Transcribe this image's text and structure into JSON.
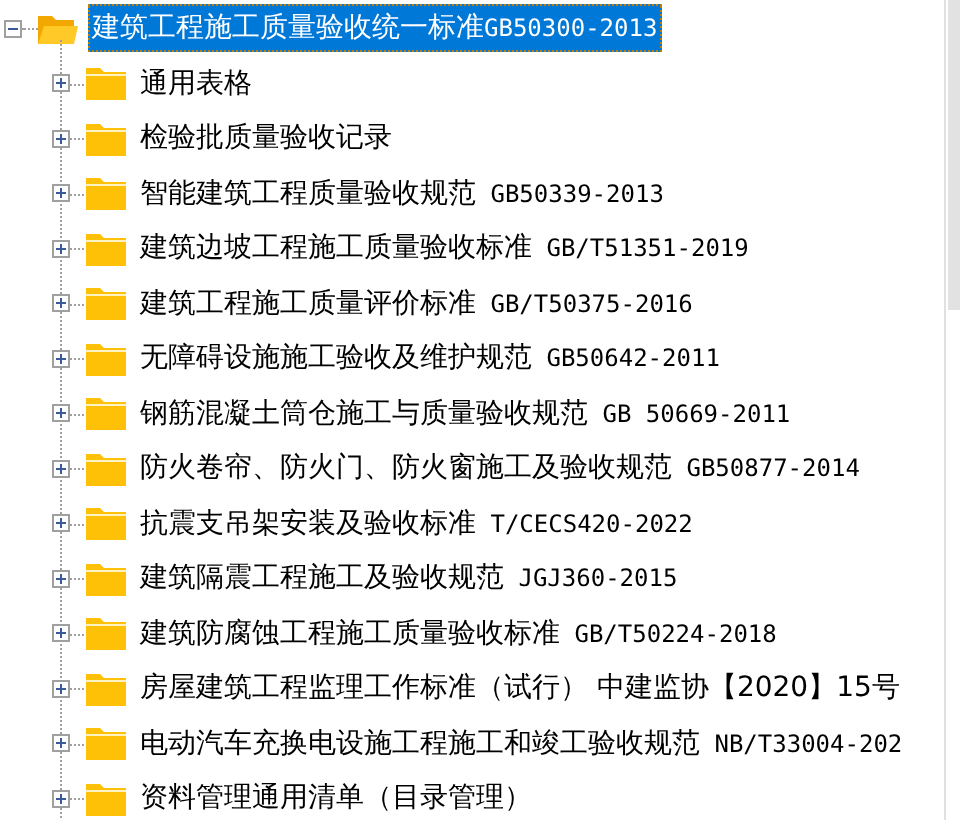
{
  "tree": {
    "root": {
      "name": "建筑工程施工质量验收统一标准",
      "code": "GB50300-2013",
      "expanded": true,
      "selected": true,
      "children": [
        {
          "name": "通用表格",
          "expanded": false,
          "selected": false
        },
        {
          "name": "检验批质量验收记录",
          "expanded": false,
          "selected": false
        },
        {
          "name": "智能建筑工程质量验收规范",
          "code": " GB50339-2013",
          "expanded": false,
          "selected": false
        },
        {
          "name": "建筑边坡工程施工质量验收标准",
          "code": " GB/T51351-2019",
          "expanded": false,
          "selected": false
        },
        {
          "name": "建筑工程施工质量评价标准",
          "code": " GB/T50375-2016",
          "expanded": false,
          "selected": false
        },
        {
          "name": "无障碍设施施工验收及维护规范",
          "code": " GB50642-2011",
          "expanded": false,
          "selected": false
        },
        {
          "name": "钢筋混凝土筒仓施工与质量验收规范",
          "code": " GB 50669-2011",
          "expanded": false,
          "selected": false
        },
        {
          "name": "防火卷帘、防火门、防火窗施工及验收规范",
          "code": " GB50877-2014",
          "expanded": false,
          "selected": false
        },
        {
          "name": "抗震支吊架安装及验收标准",
          "code": " T/CECS420-2022",
          "expanded": false,
          "selected": false
        },
        {
          "name": "建筑隔震工程施工及验收规范",
          "code": " JGJ360-2015",
          "expanded": false,
          "selected": false
        },
        {
          "name": "建筑防腐蚀工程施工质量验收标准",
          "code": " GB/T50224-2018",
          "expanded": false,
          "selected": false
        },
        {
          "name": "房屋建筑工程监理工作标准（试行）  中建监协【2020】15号",
          "expanded": false,
          "selected": false
        },
        {
          "name": "电动汽车充换电设施工程施工和竣工验收规范",
          "code": " NB/T33004-202",
          "expanded": false,
          "selected": false
        },
        {
          "name": "资料管理通用清单（目录管理）",
          "expanded": false,
          "selected": false
        }
      ]
    }
  }
}
